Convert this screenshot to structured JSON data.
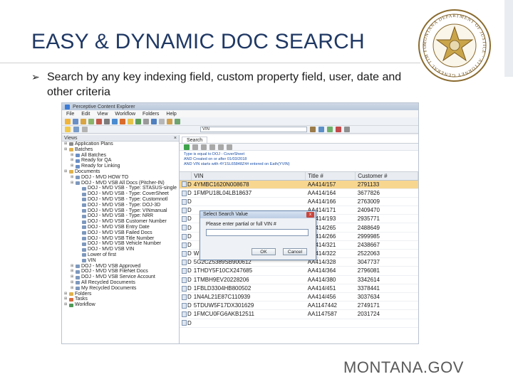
{
  "slide": {
    "title": "EASY & DYNAMIC DOC SEARCH",
    "bullet": "Search by any key indexing field, custom property field, user, date and other criteria",
    "footer": "MONTANA.GOV",
    "seal_text": "MONTANA DEPARTMENT OF JUSTICE · ATTORNEY GENERAL TIM FOX",
    "title_color": "#1f3864"
  },
  "app": {
    "window_title": "Perceptive Content Explorer",
    "menu": [
      "File",
      "Edit",
      "View",
      "Workflow",
      "Folders",
      "Help"
    ],
    "toolbar_field_value": "VIN",
    "view_pane": {
      "label": "Views",
      "tree": [
        {
          "label": "Application Plans",
          "level": 1,
          "icon": "gear-icon"
        },
        {
          "label": "Batches",
          "level": 1,
          "icon": "folder-icon"
        },
        {
          "label": "All Batches",
          "level": 2,
          "icon": "batch-icon"
        },
        {
          "label": "Ready for QA",
          "level": 2,
          "icon": "batch-icon"
        },
        {
          "label": "Ready for Linking",
          "level": 2,
          "icon": "batch-icon"
        },
        {
          "label": "Documents",
          "level": 1,
          "icon": "folder-icon"
        },
        {
          "label": "DOJ - MVD HOW TO",
          "level": 2,
          "icon": "doc-icon"
        },
        {
          "label": "DOJ - MVD VSB All Docs (Pitcher-IN)",
          "level": 2,
          "icon": "doc-icon"
        },
        {
          "label": "DOJ - MVD VSB - Type: STASUS-single",
          "level": 3,
          "icon": "doc-icon"
        },
        {
          "label": "DOJ - MVD VSB - Type: CoverSheet",
          "level": 3,
          "icon": "doc-icon"
        },
        {
          "label": "DOJ - MVD VSB - Type: Customnotl",
          "level": 3,
          "icon": "doc-icon"
        },
        {
          "label": "DOJ - MVD VSB - Type: DOJ-3D",
          "level": 3,
          "icon": "doc-icon"
        },
        {
          "label": "DOJ - MVD VSB - Type: VINmanual",
          "level": 3,
          "icon": "doc-icon"
        },
        {
          "label": "DOJ - MVD VSB - Type: NRR",
          "level": 3,
          "icon": "doc-icon"
        },
        {
          "label": "DOJ - MVD VSB Customer Number",
          "level": 3,
          "icon": "doc-icon"
        },
        {
          "label": "DOJ - MVD VSB Entry Date",
          "level": 3,
          "icon": "doc-icon"
        },
        {
          "label": "DOJ - MVD VSB Failed Docs",
          "level": 3,
          "icon": "doc-icon"
        },
        {
          "label": "DOJ - MVD VSB Title Number",
          "level": 3,
          "icon": "doc-icon"
        },
        {
          "label": "DOJ - MVD VSB Vehicle Number",
          "level": 3,
          "icon": "doc-icon"
        },
        {
          "label": "DOJ - MVD VSB VIN",
          "level": 3,
          "icon": "doc-icon"
        },
        {
          "label": "Lower of first",
          "level": 3,
          "icon": "doc-icon"
        },
        {
          "label": "VIN",
          "level": 3,
          "icon": "doc-icon"
        },
        {
          "label": "DOJ - MVD VSB Approved",
          "level": 2,
          "icon": "doc-icon"
        },
        {
          "label": "DOJ - MVD VSB FileNet Docs",
          "level": 2,
          "icon": "doc-icon"
        },
        {
          "label": "DOJ - MVD VSB Service Account",
          "level": 2,
          "icon": "doc-icon"
        },
        {
          "label": "All Recycled Documents",
          "level": 2,
          "icon": "doc-icon"
        },
        {
          "label": "My Recycled Documents",
          "level": 2,
          "icon": "doc-icon"
        },
        {
          "label": "Folders",
          "level": 1,
          "icon": "folder-icon"
        },
        {
          "label": "Tasks",
          "level": 1,
          "icon": "task-icon"
        },
        {
          "label": "Workflow",
          "level": 1,
          "icon": "workflow-icon"
        }
      ]
    },
    "search_pane": {
      "tab_label": "Search",
      "criteria": [
        "Type is equal to DOJ - CoverSheet",
        "AND Created on or after 01/03/2018",
        "AND VIN starts with 4Y1SL65848Z4# entered on Eath(YVIN)"
      ],
      "columns": [
        "VIN",
        "Title #",
        "Customer #"
      ],
      "rows": [
        {
          "vin": "4YMBC1620N008678",
          "title": "AA414/157",
          "customer": "2791133",
          "selected": true
        },
        {
          "vin": "1FMPU18L04LB18637",
          "title": "AA414/164",
          "customer": "3677826",
          "selected": false
        },
        {
          "vin": "",
          "title": "AA414/166",
          "customer": "2763009",
          "selected": false
        },
        {
          "vin": "",
          "title": "AA414/171",
          "customer": "2409470",
          "selected": false
        },
        {
          "vin": "",
          "title": "AA414/193",
          "customer": "2935771",
          "selected": false
        },
        {
          "vin": "",
          "title": "AA414/265",
          "customer": "2488649",
          "selected": false
        },
        {
          "vin": "",
          "title": "AA414/266",
          "customer": "2999985",
          "selected": false
        },
        {
          "vin": "",
          "title": "AA414/321",
          "customer": "2438667",
          "selected": false
        },
        {
          "vin": "WBAFA53501LM67251",
          "title": "AA414/322",
          "customer": "2522063",
          "selected": false
        },
        {
          "vin": "5G2CZ5389SB900612",
          "title": "AA414/328",
          "customer": "3047737",
          "selected": false
        },
        {
          "vin": "1THDY5F10CX247685",
          "title": "AA414/364",
          "customer": "2796081",
          "selected": false
        },
        {
          "vin": "1TMBH9EV20228206",
          "title": "AA414/380",
          "customer": "3342614",
          "selected": false
        },
        {
          "vin": "1FBLD3304HB800502",
          "title": "AA414/451",
          "customer": "3378441",
          "selected": false
        },
        {
          "vin": "1N4AL21E87C110939",
          "title": "AA414/456",
          "customer": "3037634",
          "selected": false
        },
        {
          "vin": "5TDUW5F17DX301629",
          "title": "AA1147442",
          "customer": "2749171",
          "selected": false
        },
        {
          "vin": "1FMCU0FG6AKB12511",
          "title": "AA1147587",
          "customer": "2031724",
          "selected": false
        },
        {
          "vin": "",
          "title": "",
          "customer": "",
          "selected": false
        }
      ],
      "row_prefix": "D"
    },
    "dialog": {
      "title": "Select Search Value",
      "label": "Please enter partial or full VIN #",
      "ok_label": "OK",
      "cancel_label": "Cancel",
      "close_label": "x"
    },
    "colors": {
      "selected_row": "#f7d68f",
      "criteria_text": "#1a4fa8",
      "window_border": "#b9c3cf"
    }
  }
}
